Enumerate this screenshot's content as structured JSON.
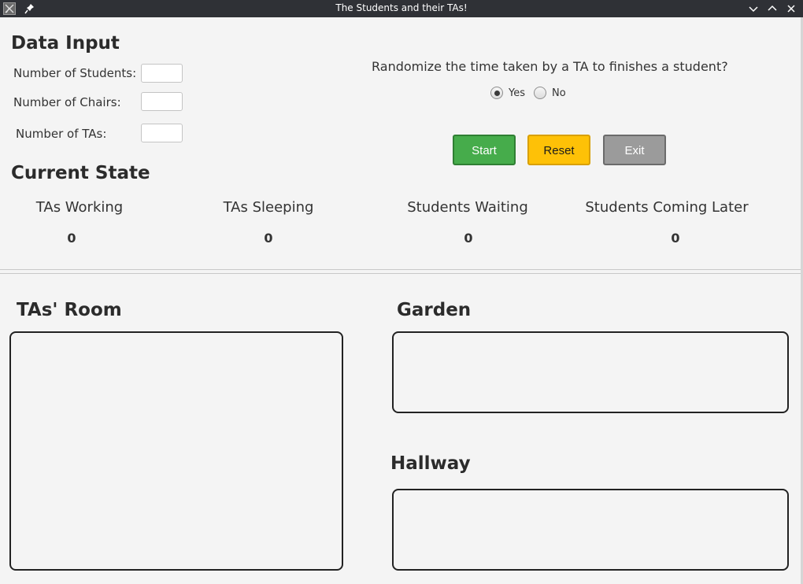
{
  "window": {
    "title": "The Students and their TAs!",
    "icons": [
      "app-icon",
      "pin-icon",
      "minimize-icon",
      "maximize-icon",
      "close-icon"
    ]
  },
  "data_input": {
    "heading": "Data Input",
    "students_label": "Number of Students:",
    "students_value": "",
    "chairs_label": "Number of Chairs:",
    "chairs_value": "",
    "tas_label": "Number of TAs:",
    "tas_value": ""
  },
  "randomize": {
    "question": "Randomize the time taken by a TA to finishes a student?",
    "options": [
      {
        "label": "Yes",
        "selected": true
      },
      {
        "label": "No",
        "selected": false
      }
    ]
  },
  "buttons": {
    "start": "Start",
    "reset": "Reset",
    "exit": "Exit",
    "colors": {
      "start": "#46ac4b",
      "reset": "#fec107",
      "exit": "#9b9b9b"
    }
  },
  "current_state": {
    "heading": "Current State",
    "stats": [
      {
        "label": "TAs Working",
        "value": "0"
      },
      {
        "label": "TAs Sleeping",
        "value": "0"
      },
      {
        "label": "Students Waiting",
        "value": "0"
      },
      {
        "label": "Students Coming Later",
        "value": "0"
      }
    ]
  },
  "rooms": {
    "tas_room": "TAs' Room",
    "garden": "Garden",
    "hallway": "Hallway"
  }
}
